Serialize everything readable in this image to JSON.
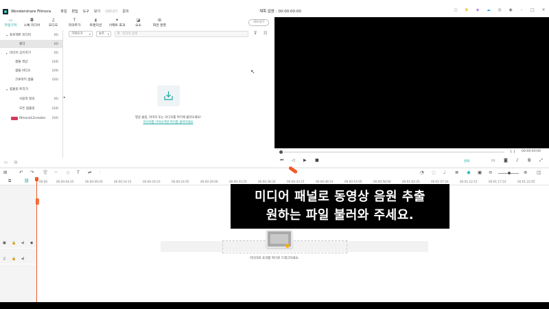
{
  "app": {
    "name": "Wondershare Filmora",
    "project_title": "제목 없음 : 00:00:00:00"
  },
  "menu": [
    "파일",
    "편집",
    "도구",
    "보기",
    "내보내기",
    "문의"
  ],
  "ribbon_tabs": [
    {
      "label": "파일가져",
      "icon": "folder-icon",
      "active": true
    },
    {
      "label": "스톡 미디어",
      "icon": "camera-icon",
      "active": false
    },
    {
      "label": "오디오",
      "icon": "music-icon",
      "active": false
    },
    {
      "label": "자막추가",
      "icon": "text-icon",
      "active": false
    },
    {
      "label": "트랜지션",
      "icon": "transition-icon",
      "active": false
    },
    {
      "label": "이펙트 효과",
      "icon": "effects-icon",
      "active": false
    },
    {
      "label": "요소",
      "icon": "elements-icon",
      "active": false
    },
    {
      "label": "화면 분할",
      "icon": "split-screen-icon",
      "active": false
    }
  ],
  "export_label": "내보내기",
  "sidebar": {
    "items": [
      {
        "label": "프로젝트 미디어",
        "count": "(0)",
        "arrow": "▾",
        "indent": 0,
        "selected": false
      },
      {
        "label": "폴더",
        "count": "(0)",
        "arrow": "",
        "indent": 1,
        "selected": true
      },
      {
        "label": "미디어 공유하기",
        "count": "(0)",
        "arrow": "▸",
        "indent": 0,
        "selected": false
      },
      {
        "label": "샘플 색상",
        "count": "(24)",
        "arrow": "",
        "indent": 1,
        "selected": false
      },
      {
        "label": "샘플 비디오",
        "count": "(19)",
        "arrow": "",
        "indent": 1,
        "selected": false
      },
      {
        "label": "크로마키 샘플",
        "count": "(10)",
        "arrow": "",
        "indent": 1,
        "selected": false
      },
      {
        "label": "컴플릿 트리거",
        "count": "",
        "arrow": "▾",
        "indent": 0,
        "selected": false
      },
      {
        "label": "사용자 정의",
        "count": "(0)",
        "arrow": "",
        "indent": 2,
        "selected": false
      },
      {
        "label": "모든 컴플릿",
        "count": "(24)",
        "arrow": "",
        "indent": 2,
        "selected": false
      },
      {
        "label": "filmora12creator",
        "count": "(10)",
        "arrow": "",
        "indent": 0,
        "selected": false,
        "badge": true
      }
    ]
  },
  "filter": {
    "sort_label": "가져오기",
    "view_label": "뉴트",
    "search_placeholder": "미디어 검색"
  },
  "import": {
    "text": "영상 클립, 이미지 또는 오디오를 여기에 불러오세요!",
    "link": "미디어를 가져오려면 여기를 클릭하세요"
  },
  "player": {
    "time": "00:00:00:00",
    "quality": "완화"
  },
  "timeline": {
    "ticks": [
      "00:00",
      "00:00:04:25",
      "00:00:09:20",
      "00:00:14:15",
      "00:00:19:10",
      "00:00:24:05",
      "00:00:29:00",
      "00:00:33:25",
      "00:00:38:20",
      "00:00:43:15",
      "00:00:48:10",
      "00:00:53:05",
      "00:00:58:00",
      "00:01:02:25",
      "00:01:07:20",
      "00:01:12:15",
      "00:01:17:10",
      "00:01:22:05"
    ],
    "hint": "미디어와 효과를 여기로 드래그하세요."
  },
  "subtitle": {
    "line1": "미디어 패널로 동영상 음원 추출",
    "line2": "원하는 파일 불러와 주세요."
  }
}
